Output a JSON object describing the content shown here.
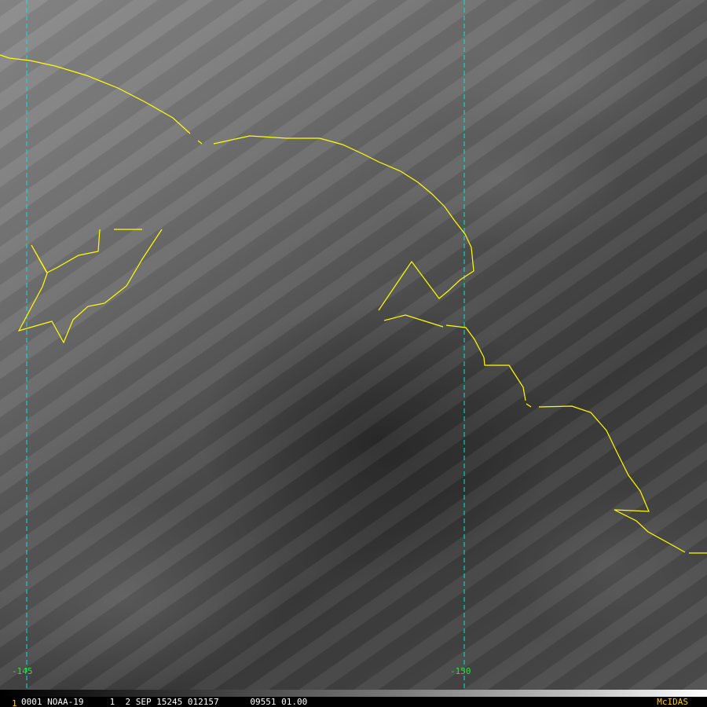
{
  "map": {
    "colors": {
      "coastline": "#ffff00",
      "gridline": "#00e5e5",
      "grid_label": "#33dd33",
      "frame_number": "#ffcc00",
      "brand": "#ffcc00"
    },
    "meridians": [
      {
        "label": "-145"
      },
      {
        "label": "-150"
      }
    ]
  },
  "status": {
    "frame_number": "1",
    "info_text": "0001 NOAA-19     1  2 SEP 15245 012157      09551 01.00",
    "brand": "McIDAS"
  }
}
